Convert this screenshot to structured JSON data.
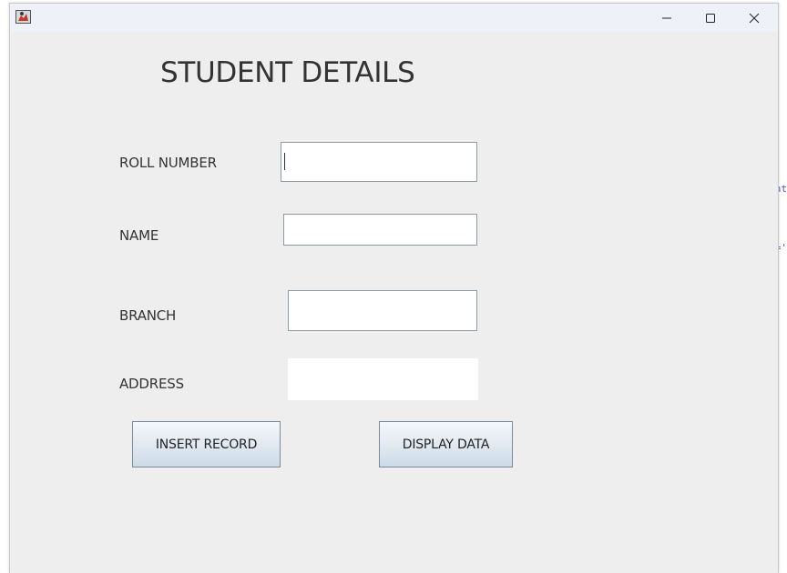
{
  "background_code": {
    "fragment_1": "nt",
    "fragment_2": "='"
  },
  "window": {
    "title": "",
    "controls": {
      "minimize": "minimize-icon",
      "maximize": "maximize-icon",
      "close": "close-icon"
    }
  },
  "form": {
    "heading": "STUDENT DETAILS",
    "fields": {
      "roll_number": {
        "label": "ROLL NUMBER",
        "value": ""
      },
      "name": {
        "label": "NAME",
        "value": ""
      },
      "branch": {
        "label": "BRANCH",
        "value": ""
      },
      "address": {
        "label": "ADDRESS",
        "value": ""
      }
    },
    "buttons": {
      "insert": "INSERT RECORD",
      "display": "DISPLAY DATA"
    }
  },
  "colors": {
    "window_bg": "#eeeeee",
    "titlebar_bg": "#eef1f8",
    "button_gradient_top": "#f4f7fa",
    "button_gradient_bottom": "#cddbe8",
    "field_border": "#8c9aa6"
  }
}
